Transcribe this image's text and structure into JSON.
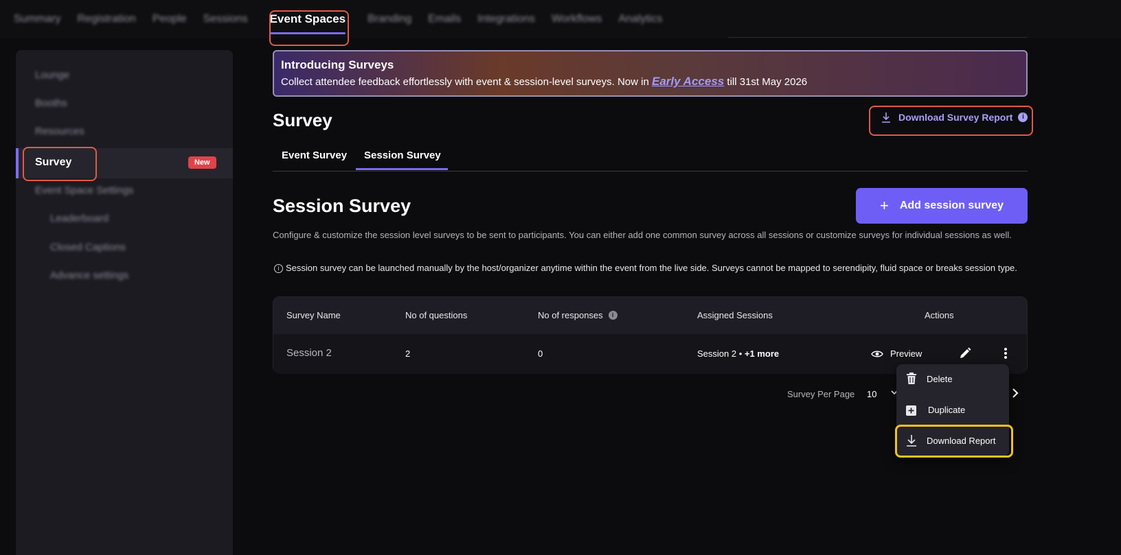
{
  "topnav": {
    "items": [
      "Summary",
      "Registration",
      "People",
      "Sessions",
      "Event Spaces",
      "Branding",
      "Emails",
      "Integrations",
      "Workflows",
      "Analytics"
    ],
    "active": "Event Spaces"
  },
  "sidebar": {
    "items": [
      "Lounge",
      "Booths",
      "Resources"
    ],
    "active_label": "Survey",
    "active_badge": "New",
    "settings_label": "Event Space Settings",
    "sub_items": [
      "Leaderboard",
      "Closed Captions",
      "Advance settings"
    ]
  },
  "banner": {
    "title": "Introducing Surveys",
    "text_before": "Collect attendee feedback effortlessly with event & session-level surveys. Now in",
    "link": "Early Access",
    "text_after": "till 31st May 2026"
  },
  "page": {
    "title": "Survey",
    "download_report_label": "Download Survey Report",
    "tabs": [
      "Event Survey",
      "Session Survey"
    ],
    "active_tab": "Session Survey"
  },
  "section": {
    "title": "Session Survey",
    "add_button": "Add session survey",
    "description": "Configure & customize the session level surveys to be sent to participants. You can either add one common survey across all sessions or customize surveys for individual sessions as well.",
    "note": "Session survey can be launched manually by the host/organizer anytime within the event from the live side. Surveys cannot be mapped to serendipity, fluid space or breaks session type."
  },
  "table": {
    "headers": {
      "name": "Survey Name",
      "questions": "No of questions",
      "responses": "No of responses",
      "sessions": "Assigned Sessions",
      "actions": "Actions"
    },
    "rows": [
      {
        "name": "Session 2",
        "questions": "2",
        "responses": "0",
        "sessions": "Session 2 •",
        "sessions_more": "+1 more",
        "preview": "Preview"
      }
    ]
  },
  "pager": {
    "label": "Survey Per Page",
    "value": "10"
  },
  "menu": {
    "items": [
      "Delete",
      "Duplicate",
      "Download Report"
    ]
  },
  "colors": {
    "accent": "#6f5ef5",
    "highlight_red": "#e25a45",
    "highlight_yellow": "#f2c21b",
    "badge": "#e0434a"
  }
}
